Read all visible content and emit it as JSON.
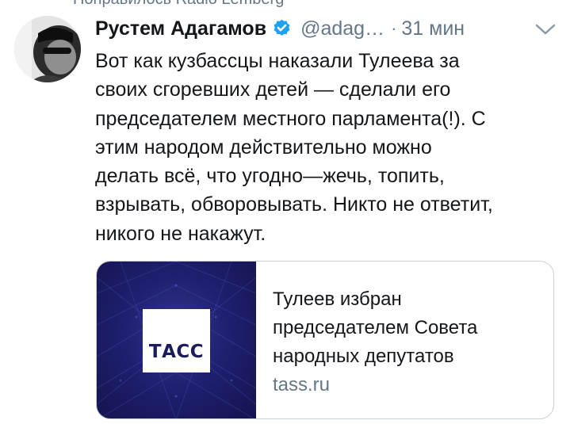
{
  "context": {
    "text": "Понравилось Radio Lemberg"
  },
  "tweet": {
    "author": {
      "name": "Рустем Адагамов",
      "handle": "@adag…",
      "verified": true
    },
    "separator": "·",
    "time": "31 мин",
    "text": "Вот как кузбассцы наказали Тулеева за\nсвоих сгоревших детей — сделали его\nпредседателем местного парламента(!). С\nэтим народом действительно можно\nделать всё, что угодно—жечь, топить,\nвзрывать, обворовывать. Никто не ответит,\nникого не накажут.",
    "card": {
      "logo_text": "ТАСС",
      "title": "Тулеев избран\nпредседателем Совета\nнародных депутатов",
      "domain": "tass.ru"
    }
  },
  "icons": {
    "verified": "verified-badge-icon",
    "menu": "chevron-down-icon",
    "avatar": "avatar-photo"
  },
  "colors": {
    "accent": "#1da1f2",
    "text_primary": "#14171a",
    "text_secondary": "#657786",
    "card_border": "#c9d1d7",
    "card_image_bg": "#1f2070"
  }
}
